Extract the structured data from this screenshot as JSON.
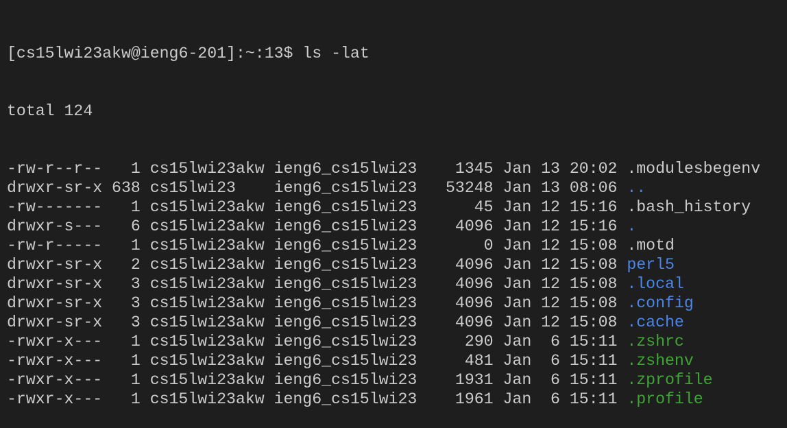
{
  "colors": {
    "background": "#1e1e1e",
    "text": "#cccccc",
    "directory": "#4a86e8",
    "executable": "#3fa535"
  },
  "prompt": "[cs15lwi23akw@ieng6-201]:~:13$ ",
  "command": "ls -lat",
  "total": "total 124",
  "entries": [
    {
      "perms": "-rw-r--r--",
      "links": "1",
      "owner": "cs15lwi23akw",
      "group": "ieng6_cs15lwi23",
      "size": "1345",
      "month": "Jan",
      "day": "13",
      "time": "20:02",
      "name": ".modulesbegenv",
      "type": "file"
    },
    {
      "perms": "drwxr-sr-x",
      "links": "638",
      "owner": "cs15lwi23",
      "group": "ieng6_cs15lwi23",
      "size": "53248",
      "month": "Jan",
      "day": "13",
      "time": "08:06",
      "name": "..",
      "type": "dir"
    },
    {
      "perms": "-rw-------",
      "links": "1",
      "owner": "cs15lwi23akw",
      "group": "ieng6_cs15lwi23",
      "size": "45",
      "month": "Jan",
      "day": "12",
      "time": "15:16",
      "name": ".bash_history",
      "type": "file"
    },
    {
      "perms": "drwxr-s---",
      "links": "6",
      "owner": "cs15lwi23akw",
      "group": "ieng6_cs15lwi23",
      "size": "4096",
      "month": "Jan",
      "day": "12",
      "time": "15:16",
      "name": ".",
      "type": "dir"
    },
    {
      "perms": "-rw-r-----",
      "links": "1",
      "owner": "cs15lwi23akw",
      "group": "ieng6_cs15lwi23",
      "size": "0",
      "month": "Jan",
      "day": "12",
      "time": "15:08",
      "name": ".motd",
      "type": "file"
    },
    {
      "perms": "drwxr-sr-x",
      "links": "2",
      "owner": "cs15lwi23akw",
      "group": "ieng6_cs15lwi23",
      "size": "4096",
      "month": "Jan",
      "day": "12",
      "time": "15:08",
      "name": "perl5",
      "type": "dir"
    },
    {
      "perms": "drwxr-sr-x",
      "links": "3",
      "owner": "cs15lwi23akw",
      "group": "ieng6_cs15lwi23",
      "size": "4096",
      "month": "Jan",
      "day": "12",
      "time": "15:08",
      "name": ".local",
      "type": "dir"
    },
    {
      "perms": "drwxr-sr-x",
      "links": "3",
      "owner": "cs15lwi23akw",
      "group": "ieng6_cs15lwi23",
      "size": "4096",
      "month": "Jan",
      "day": "12",
      "time": "15:08",
      "name": ".config",
      "type": "dir"
    },
    {
      "perms": "drwxr-sr-x",
      "links": "3",
      "owner": "cs15lwi23akw",
      "group": "ieng6_cs15lwi23",
      "size": "4096",
      "month": "Jan",
      "day": "12",
      "time": "15:08",
      "name": ".cache",
      "type": "dir"
    },
    {
      "perms": "-rwxr-x---",
      "links": "1",
      "owner": "cs15lwi23akw",
      "group": "ieng6_cs15lwi23",
      "size": "290",
      "month": "Jan",
      "day": "6",
      "time": "15:11",
      "name": ".zshrc",
      "type": "exec"
    },
    {
      "perms": "-rwxr-x---",
      "links": "1",
      "owner": "cs15lwi23akw",
      "group": "ieng6_cs15lwi23",
      "size": "481",
      "month": "Jan",
      "day": "6",
      "time": "15:11",
      "name": ".zshenv",
      "type": "exec"
    },
    {
      "perms": "-rwxr-x---",
      "links": "1",
      "owner": "cs15lwi23akw",
      "group": "ieng6_cs15lwi23",
      "size": "1931",
      "month": "Jan",
      "day": "6",
      "time": "15:11",
      "name": ".zprofile",
      "type": "exec"
    },
    {
      "perms": "-rwxr-x---",
      "links": "1",
      "owner": "cs15lwi23akw",
      "group": "ieng6_cs15lwi23",
      "size": "1961",
      "month": "Jan",
      "day": "6",
      "time": "15:11",
      "name": ".profile",
      "type": "exec"
    }
  ]
}
